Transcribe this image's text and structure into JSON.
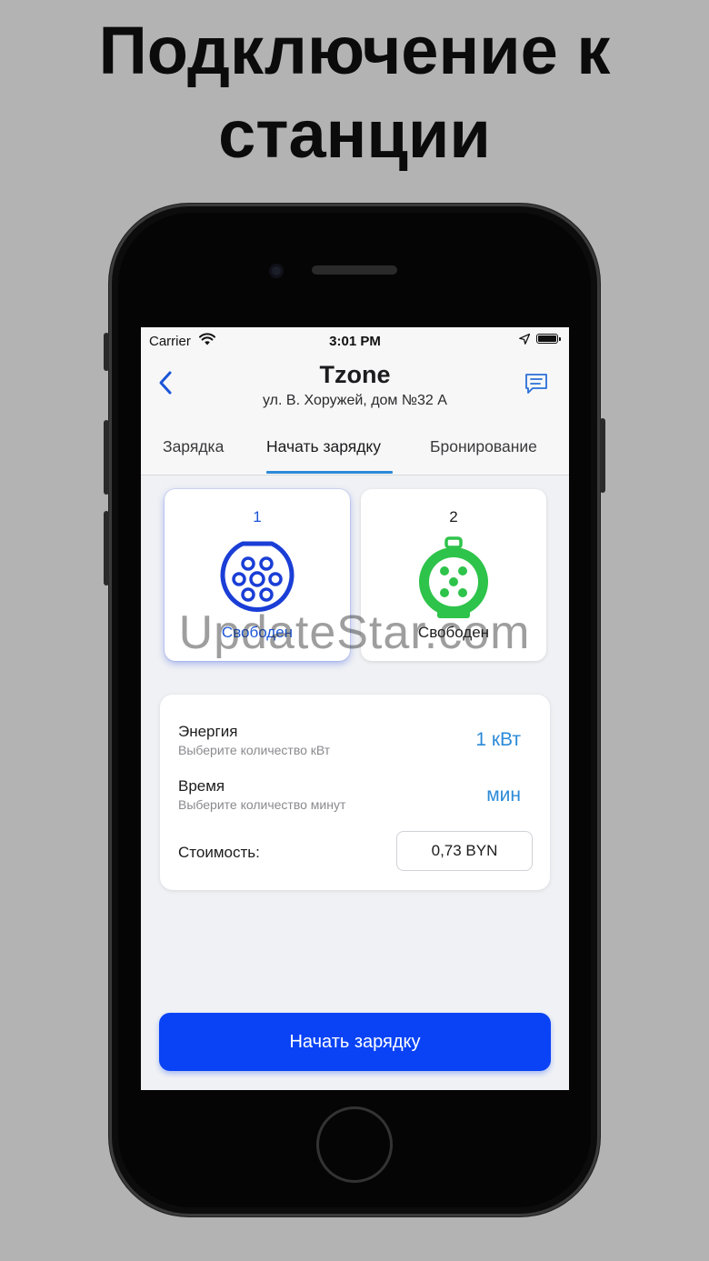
{
  "headline": {
    "line1": "Подключение к",
    "line2": "станции"
  },
  "status_bar": {
    "carrier": "Carrier",
    "time": "3:01 PM"
  },
  "nav": {
    "title": "Tzone",
    "address": "ул. В. Хоружей, дом №32 А",
    "tabs": [
      {
        "label": "Зарядка"
      },
      {
        "label": "Начать зарядку",
        "active": true
      },
      {
        "label": "Бронирование"
      }
    ]
  },
  "connectors": [
    {
      "number": "1",
      "status": "Свободен",
      "color": "#1a3ed6",
      "selected": true
    },
    {
      "number": "2",
      "status": "Свободен",
      "color": "#2ec34a",
      "selected": false
    }
  ],
  "form": {
    "energy": {
      "label": "Энергия",
      "hint": "Выберите количество кВт",
      "value": "1 кВт"
    },
    "time": {
      "label": "Время",
      "hint": "Выберите количество минут",
      "value": "мин"
    },
    "cost": {
      "label": "Стоимость:",
      "value": "0,73 BYN"
    }
  },
  "start_button": {
    "label": "Начать зарядку"
  },
  "watermark": "UpdateStar.com",
  "colors": {
    "accent": "#2b8ad8",
    "primary_button": "#0a43f5",
    "background": "#b3b3b3"
  }
}
